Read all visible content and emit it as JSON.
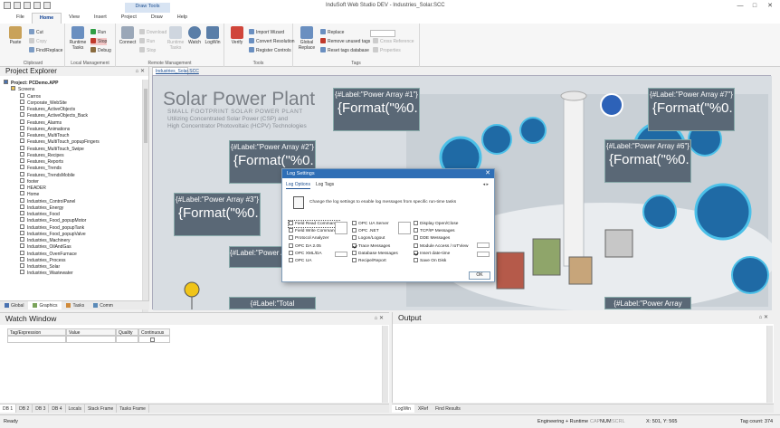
{
  "window": {
    "title": "InduSoft Web Studio DEV - Industries_Solar.SCC",
    "context_tab": "Draw Tools",
    "minimize": "—",
    "maximize": "□",
    "close": "✕"
  },
  "ribbon_tabs": [
    "File",
    "Home",
    "View",
    "Insert",
    "Project",
    "Draw",
    "Help"
  ],
  "ribbon": {
    "clipboard": {
      "label": "Clipboard",
      "paste": "Paste",
      "cut": "Cut",
      "copy": "Copy",
      "find_replace": "Find/Replace"
    },
    "local_management": {
      "label": "Local Management",
      "runtime_tasks": "Runtime Tasks",
      "run": "Run",
      "stop": "Stop",
      "debug": "Debug"
    },
    "remote_management": {
      "label": "Remote Management",
      "connect": "Connect",
      "download": "Download",
      "run": "Run",
      "stop": "Stop",
      "runtime_tasks": "Runtime Tasks",
      "watch": "Watch",
      "loglin": "LogWin"
    },
    "tools": {
      "label": "Tools",
      "verify": "Verify",
      "import_wizard": "Import Wizard",
      "convert_resolution": "Convert Resolution",
      "register_controls": "Register Controls"
    },
    "tags": {
      "label": "Tags",
      "global_replace": "Global Replace",
      "replace": "Replace",
      "remove_unused": "Remove unused tags",
      "reset_tags_db": "Reset tags database",
      "cross_reference": "Cross Reference",
      "properties": "Properties"
    }
  },
  "project_explorer": {
    "title": "Project Explorer",
    "pin": "⌂ ✕",
    "root": "Project: PCDemo.APP",
    "screens_folder": "Screens",
    "items": [
      "Carros",
      "Corporate_WebSite",
      "Features_ActiveObjects",
      "Features_ActiveObjects_Back",
      "Features_Alarms",
      "Features_Animations",
      "Features_MultiTouch",
      "Features_MultiTouch_popupFingers",
      "Features_MultiTouch_Swipe",
      "Features_Recipes",
      "Features_Reports",
      "Features_Trends",
      "Features_TrendsMobile",
      "footer",
      "HEADER",
      "Home",
      "Industries_ControlPanel",
      "Industries_Energy",
      "Industries_Food",
      "Industries_Food_popupMotor",
      "Industries_Food_popupTank",
      "Industries_Food_popupValve",
      "Industries_Machinery",
      "Industries_OilAndGas",
      "Industries_OvenFurnace",
      "Industries_Process",
      "Industries_Solar",
      "Industries_Wastewater"
    ],
    "tabs": [
      "Global",
      "Graphics",
      "Tasks",
      "Comm"
    ]
  },
  "document": {
    "tab": "Industries_Solar.SCC",
    "heading": "Solar Power Plant",
    "sub1": "SMALL FOOTPRINT SOLAR POWER PLANT",
    "sub2": "Utilizing Concentrated Solar Power (CSP) and",
    "sub3": "High Concentrator Photovoltaic (HCPV) Technologies",
    "boxes": [
      {
        "label": "{#Label:\"Power Array #1\"}",
        "format": "{Format(\"%0."
      },
      {
        "label": "{#Label:\"Power Array #2\"}",
        "format": "{Format(\"%0."
      },
      {
        "label": "{#Label:\"Power Array #3\"}",
        "format": "{Format(\"%0."
      },
      {
        "label": "{#Label:\"Power Array #4\"}",
        "format": ""
      },
      {
        "label": "{#Label:\"Power Array #6\"}",
        "format": "{Format(\"%0."
      },
      {
        "label": "{#Label:\"Power Array #7\"}",
        "format": "{Format(\"%0."
      },
      {
        "label": "{#Label:\"Total",
        "format": ""
      },
      {
        "label": "{#Label:\"Power Array",
        "format": ""
      }
    ]
  },
  "log_dialog": {
    "title": "Log Settings",
    "close": "✕",
    "tabs": [
      "Log Options",
      "Log Tags"
    ],
    "arrows": "◂ ▸",
    "description": "Change the log settings to enable log messages from specific run-time tasks",
    "col1": [
      {
        "label": "Field Read Commands",
        "checked": false
      },
      {
        "label": "Field Write Commands",
        "checked": false
      },
      {
        "label": "Protocol Analyzer",
        "checked": false
      },
      {
        "label": "OPC DA 2.05",
        "checked": false
      },
      {
        "label": "OPC XML/DA",
        "checked": false
      },
      {
        "label": "OPC UA",
        "checked": false
      }
    ],
    "col2": [
      {
        "label": "OPC UA Server",
        "checked": false
      },
      {
        "label": "OPC .NET",
        "checked": false
      },
      {
        "label": "Logon/Logout",
        "checked": false
      },
      {
        "label": "Trace Messages",
        "checked": true
      },
      {
        "label": "Database Messages",
        "checked": false
      },
      {
        "label": "Recipe/Report",
        "checked": false
      }
    ],
    "col3": [
      {
        "label": "Display Open/Close",
        "checked": false
      },
      {
        "label": "TCP/IP Messages",
        "checked": false
      },
      {
        "label": "DDE Messages",
        "checked": false
      },
      {
        "label": "Module Access / IoTView",
        "checked": false
      },
      {
        "label": "Insert date-time",
        "checked": true
      },
      {
        "label": "Save On Disk",
        "checked": false
      }
    ],
    "ok": "OK"
  },
  "watch_window": {
    "title": "Watch Window",
    "pin": "⌂ ✕",
    "columns": [
      "Tag/Expression",
      "Value",
      "Quality",
      "Continuous"
    ],
    "tabs": [
      "DB 1",
      "DB 2",
      "DB 3",
      "DB 4",
      "Locals",
      "Stack Frame",
      "Tasks Frame"
    ]
  },
  "output": {
    "title": "Output",
    "pin": "⌂ ✕",
    "tabs": [
      "LogWin",
      "XRef",
      "Find Results"
    ]
  },
  "status_bar": {
    "left": "Ready",
    "mode": "Engineering + Runtime",
    "caps": "CAP",
    "num": "NUM",
    "scrl": "SCRL",
    "coords": "X: 501, Y: 565",
    "tag_count": "Tag count: 374"
  },
  "colors": {
    "accent": "#2f6fb6",
    "canvas_box": "#5a6876"
  }
}
